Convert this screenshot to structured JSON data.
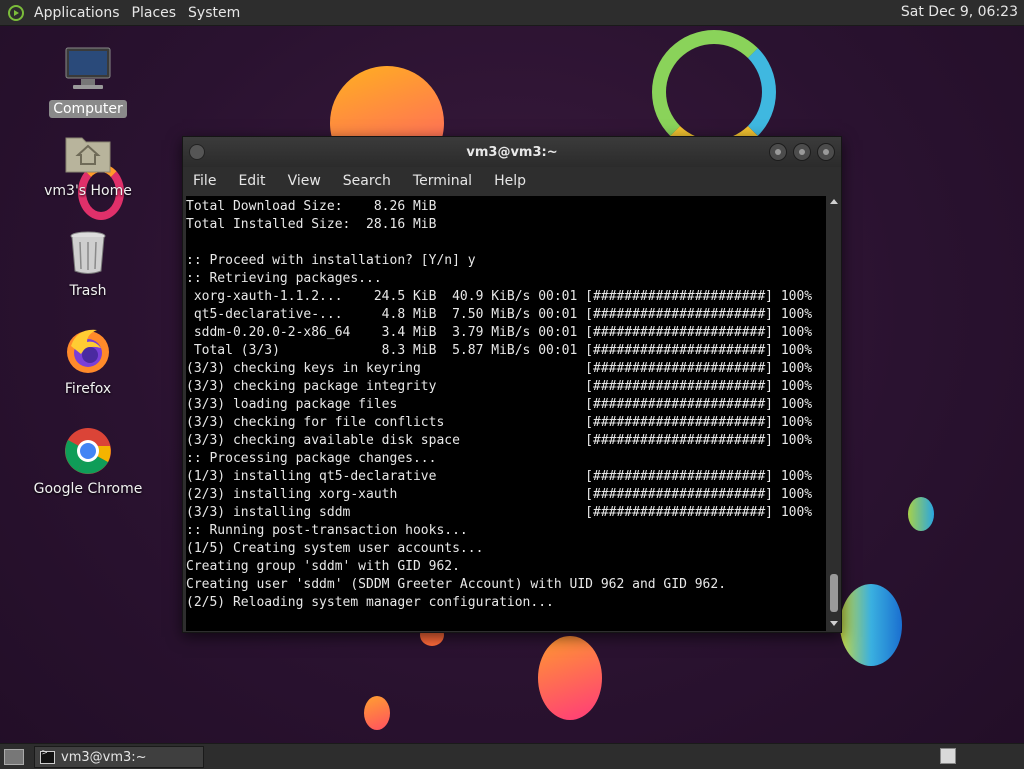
{
  "top_panel": {
    "menu": [
      "Applications",
      "Places",
      "System"
    ],
    "clock": "Sat Dec 9, 06:23"
  },
  "desktop_icons": {
    "computer": "Computer",
    "home": "vm3's Home",
    "trash": "Trash",
    "firefox": "Firefox",
    "chrome": "Google Chrome"
  },
  "terminal": {
    "title": "vm3@vm3:~",
    "menu": [
      "File",
      "Edit",
      "View",
      "Search",
      "Terminal",
      "Help"
    ],
    "lines": [
      "Total Download Size:    8.26 MiB",
      "Total Installed Size:  28.16 MiB",
      "",
      ":: Proceed with installation? [Y/n] y",
      ":: Retrieving packages...",
      " xorg-xauth-1.1.2...    24.5 KiB  40.9 KiB/s 00:01 [######################] 100%",
      " qt5-declarative-...     4.8 MiB  7.50 MiB/s 00:01 [######################] 100%",
      " sddm-0.20.0-2-x86_64    3.4 MiB  3.79 MiB/s 00:01 [######################] 100%",
      " Total (3/3)             8.3 MiB  5.87 MiB/s 00:01 [######################] 100%",
      "(3/3) checking keys in keyring                     [######################] 100%",
      "(3/3) checking package integrity                   [######################] 100%",
      "(3/3) loading package files                        [######################] 100%",
      "(3/3) checking for file conflicts                  [######################] 100%",
      "(3/3) checking available disk space                [######################] 100%",
      ":: Processing package changes...",
      "(1/3) installing qt5-declarative                   [######################] 100%",
      "(2/3) installing xorg-xauth                        [######################] 100%",
      "(3/3) installing sddm                              [######################] 100%",
      ":: Running post-transaction hooks...",
      "(1/5) Creating system user accounts...",
      "Creating group 'sddm' with GID 962.",
      "Creating user 'sddm' (SDDM Greeter Account) with UID 962 and GID 962.",
      "(2/5) Reloading system manager configuration..."
    ]
  },
  "taskbar": {
    "task_label": "vm3@vm3:~"
  },
  "colors": {
    "desktop_bg": "#2a1230",
    "panel_bg": "#2d2d2d",
    "terminal_bg": "#000000",
    "terminal_fg": "#e8e8e8"
  }
}
